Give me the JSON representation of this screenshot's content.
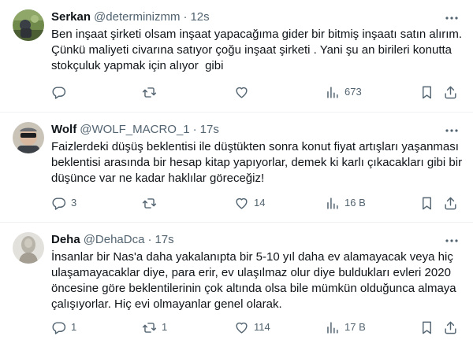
{
  "tweets": [
    {
      "name": "Serkan",
      "handle": "@determinizmm",
      "dot": "·",
      "time": "12s",
      "text": "Ben inşaat şirketi olsam inşaat yapacağıma gider bir bitmiş inşaatı satın alırım. Çünkü maliyeti civarına satıyor çoğu inşaat şirketi . Yani şu an birileri konutta stokçuluk yapmak için alıyor  gibi",
      "replies": "",
      "retweets": "",
      "likes": "",
      "views": "673",
      "avatar_icon": "avatar-serkan"
    },
    {
      "name": "Wolf",
      "handle": "@WOLF_MACRO_1",
      "dot": "·",
      "time": "17s",
      "text": "Faizlerdeki düşüş beklentisi ile düştükten sonra konut fiyat artışları yaşanması beklentisi arasında bir hesap kitap yapıyorlar, demek ki karlı çıkacakları gibi bir düşünce var ne kadar haklılar göreceğiz!",
      "replies": "3",
      "retweets": "",
      "likes": "14",
      "views": "16 B",
      "avatar_icon": "avatar-wolf"
    },
    {
      "name": "Deha",
      "handle": "@DehaDca",
      "dot": "·",
      "time": "17s",
      "text": "İnsanlar bir Nas'a daha yakalanıpta bir 5-10 yıl daha ev alamayacak veya hiç ulaşamayacaklar diye, para erir, ev ulaşılmaz olur diye buldukları evleri 2020 öncesine göre beklentilerinin çok altında olsa bile mümkün olduğunca almaya çalışıyorlar. Hiç evi olmayanlar genel olarak.",
      "replies": "1",
      "retweets": "1",
      "likes": "114",
      "views": "17 B",
      "avatar_icon": "avatar-deha"
    }
  ],
  "icons": {
    "reply": "reply-icon",
    "retweet": "retweet-icon",
    "like": "heart-icon",
    "views": "views-icon",
    "bookmark": "bookmark-icon",
    "share": "share-icon",
    "more": "more-icon"
  },
  "colors": {
    "text": "#0f1419",
    "secondary": "#536471",
    "divider": "#eff3f4"
  }
}
